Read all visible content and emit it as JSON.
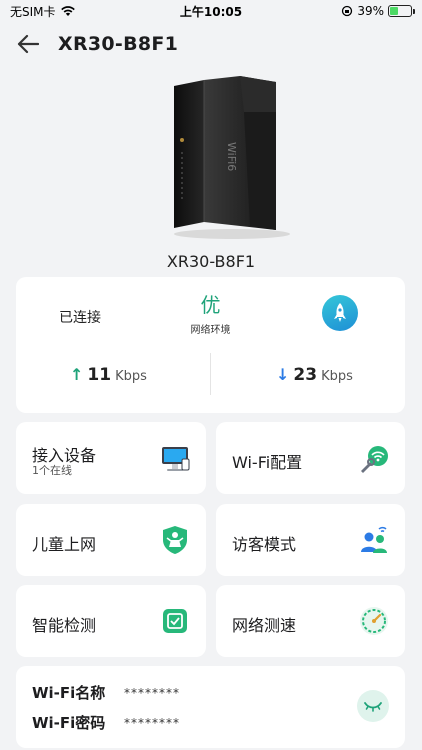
{
  "status_bar": {
    "carrier": "无SIM卡",
    "time": "上午10:05",
    "battery_percent": "39%",
    "battery_level": 0.39
  },
  "header": {
    "title": "XR30-B8F1"
  },
  "device": {
    "name": "XR30-B8F1",
    "brand_text": "WiFi6"
  },
  "status": {
    "connection": "已连接",
    "quality_grade": "优",
    "quality_label": "网络环境",
    "upload_value": "11",
    "upload_unit": "Kbps",
    "download_value": "23",
    "download_unit": "Kbps"
  },
  "tiles": [
    {
      "label": "接入设备",
      "sub": "1个在线",
      "icon": "monitor-icon"
    },
    {
      "label": "Wi-Fi配置",
      "icon": "wifi-settings-icon"
    },
    {
      "label": "儿童上网",
      "icon": "child-shield-icon"
    },
    {
      "label": "访客模式",
      "icon": "guest-users-icon"
    },
    {
      "label": "智能检测",
      "icon": "smart-check-icon"
    },
    {
      "label": "网络测速",
      "icon": "speed-test-icon"
    }
  ],
  "wifi": {
    "name_label": "Wi-Fi名称",
    "name_value": "********",
    "password_label": "Wi-Fi密码",
    "password_value": "********"
  },
  "colors": {
    "accent_green": "#1fa37a",
    "accent_blue": "#2c7be5",
    "background": "#f2f3f5"
  }
}
